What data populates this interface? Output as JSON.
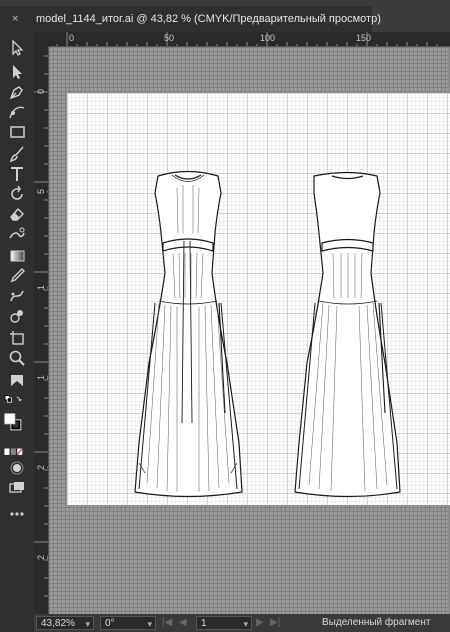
{
  "tab": {
    "close_label": "×",
    "title": "model_1144_итог.ai @ 43,82 % (CMYK/Предварительный просмотр)"
  },
  "ruler": {
    "top_labels": [
      "0",
      "50",
      "100",
      "150"
    ],
    "left_labels": [
      "0",
      "5 0",
      "1 0 0",
      "1 5 0",
      "2 0 0",
      "2 5 0"
    ]
  },
  "status": {
    "zoom": "43,82%",
    "rotation": "0°",
    "artboard_number": "1",
    "info_text": "Выделенный фрагмент"
  },
  "colors": {
    "accent": "#e53030"
  }
}
